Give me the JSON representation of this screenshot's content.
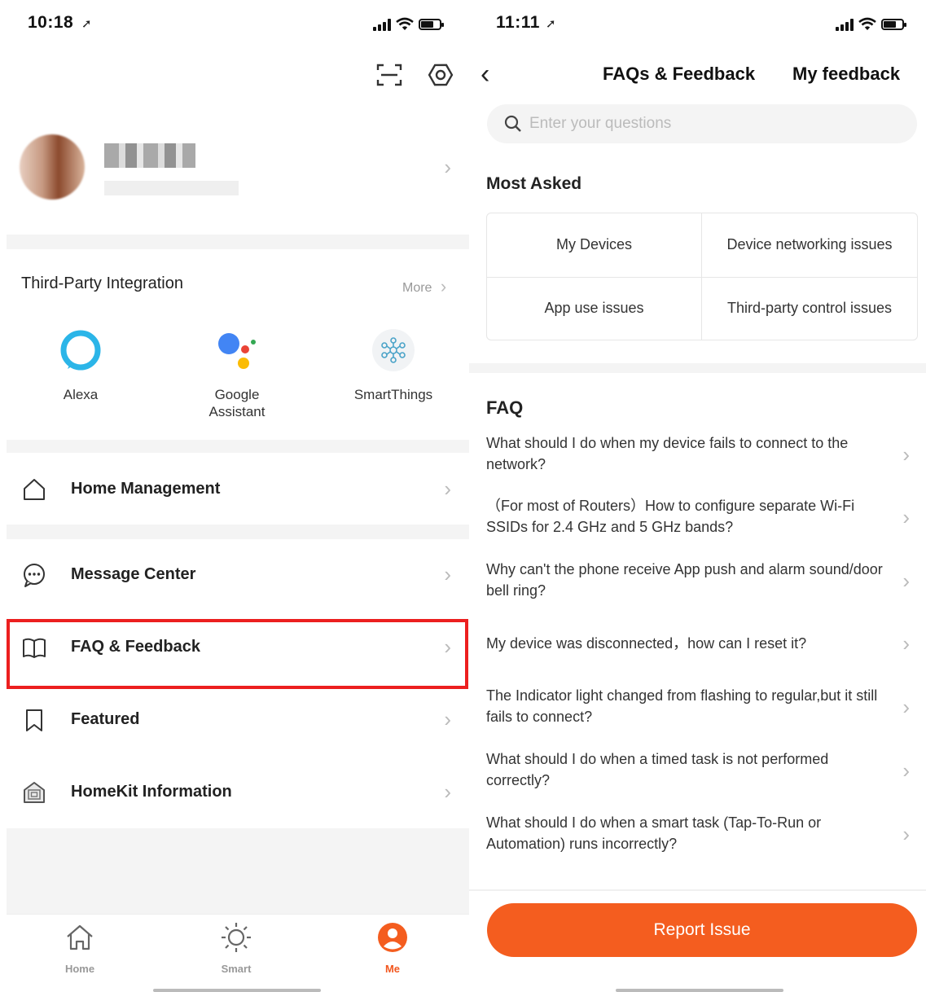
{
  "colors": {
    "accent": "#f45d1f",
    "highlight": "#ec1f1f",
    "alexa": "#2bb5e8"
  },
  "left_screen": {
    "status": {
      "time": "10:18"
    },
    "profile": {},
    "third_party": {
      "title": "Third-Party Integration",
      "more": "More",
      "items": [
        {
          "label": "Alexa",
          "icon": "alexa-icon"
        },
        {
          "label": "Google Assistant",
          "icon": "google-assistant-icon"
        },
        {
          "label": "SmartThings",
          "icon": "smartthings-icon"
        }
      ]
    },
    "menu": [
      {
        "label": "Home Management",
        "icon": "home-icon"
      },
      {
        "label": "Message Center",
        "icon": "message-icon"
      },
      {
        "label": "FAQ & Feedback",
        "icon": "book-icon"
      },
      {
        "label": "Featured",
        "icon": "bookmark-icon"
      },
      {
        "label": "HomeKit Information",
        "icon": "homekit-icon"
      }
    ],
    "tabs": [
      {
        "label": "Home",
        "icon": "home-tab-icon",
        "active": false
      },
      {
        "label": "Smart",
        "icon": "sun-icon",
        "active": false
      },
      {
        "label": "Me",
        "icon": "person-icon",
        "active": true
      }
    ]
  },
  "right_screen": {
    "status": {
      "time": "11:11"
    },
    "nav": {
      "title": "FAQs & Feedback",
      "right_link": "My feedback"
    },
    "search": {
      "placeholder": "Enter your questions",
      "value": ""
    },
    "most_asked": {
      "title": "Most Asked",
      "items": [
        "My Devices",
        "Device networking issues",
        "App use issues",
        "Third-party control issues"
      ]
    },
    "faq": {
      "title": "FAQ",
      "items": [
        "What should I do when my device fails to connect to the network?",
        "（For most of Routers）How to configure separate Wi-Fi SSIDs for 2.4 GHz and 5 GHz bands?",
        "Why can't the phone receive App push and alarm sound/door bell ring?",
        "My device was disconnected，how can I reset it?",
        "The Indicator light changed from flashing to regular,but it still fails to connect?",
        "What should I do when a timed task is not performed correctly?",
        "What should I do when a smart task (Tap-To-Run or Automation) runs incorrectly?"
      ]
    },
    "report_button": "Report Issue"
  }
}
